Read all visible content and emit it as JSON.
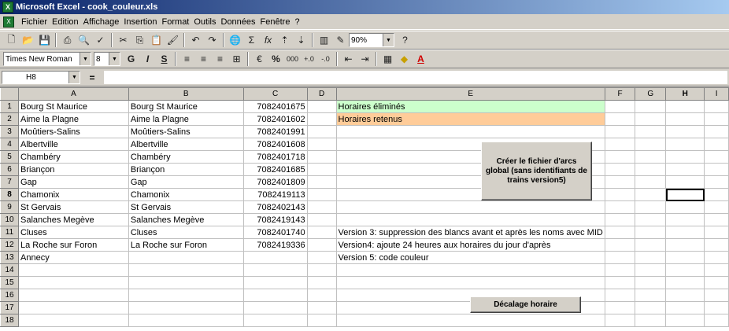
{
  "window": {
    "title": "Microsoft Excel - cook_couleur.xls"
  },
  "menu": [
    "Fichier",
    "Edition",
    "Affichage",
    "Insertion",
    "Format",
    "Outils",
    "Données",
    "Fenêtre",
    "?"
  ],
  "toolbar": {
    "zoom": "90%"
  },
  "format_toolbar": {
    "font": "Times New Roman",
    "size": "8",
    "bold": "G",
    "italic": "I",
    "underline": "S",
    "percent": "%",
    "thousands": "000"
  },
  "formula_bar": {
    "cell_ref": "H8",
    "equals": "="
  },
  "columns": [
    "A",
    "B",
    "C",
    "D",
    "E",
    "F",
    "G",
    "H",
    "I"
  ],
  "rows": [
    {
      "n": "1",
      "a": "Bourg St Maurice",
      "b": "Bourg St Maurice",
      "c": "7082401675",
      "e": "Horaires éliminés"
    },
    {
      "n": "2",
      "a": "Aime la Plagne",
      "b": "Aime la Plagne",
      "c": "7082401602",
      "e": "Horaires retenus"
    },
    {
      "n": "3",
      "a": "Moûtiers-Salins",
      "b": "Moûtiers-Salins",
      "c": "7082401991",
      "e": ""
    },
    {
      "n": "4",
      "a": "Albertville",
      "b": "Albertville",
      "c": "7082401608",
      "e": ""
    },
    {
      "n": "5",
      "a": "Chambéry",
      "b": "Chambéry",
      "c": "7082401718",
      "e": ""
    },
    {
      "n": "6",
      "a": "Briançon",
      "b": "Briançon",
      "c": "7082401685",
      "e": ""
    },
    {
      "n": "7",
      "a": "Gap",
      "b": "Gap",
      "c": "7082401809",
      "e": ""
    },
    {
      "n": "8",
      "a": "Chamonix",
      "b": "Chamonix",
      "c": "7082419113",
      "e": ""
    },
    {
      "n": "9",
      "a": "St Gervais",
      "b": "St Gervais",
      "c": "7082402143",
      "e": ""
    },
    {
      "n": "10",
      "a": "Salanches Megève",
      "b": "Salanches Megève",
      "c": "7082419143",
      "e": ""
    },
    {
      "n": "11",
      "a": "Cluses",
      "b": "Cluses",
      "c": "7082401740",
      "e": "Version 3: suppression des blancs avant et après les noms avec MID"
    },
    {
      "n": "12",
      "a": "La Roche sur Foron",
      "b": "La Roche sur Foron",
      "c": "7082419336",
      "e": "Version4: ajoute 24 heures aux horaires du jour d'après"
    },
    {
      "n": "13",
      "a": "Annecy",
      "b": "",
      "c": "",
      "e": "Version 5: code couleur"
    },
    {
      "n": "14",
      "a": "",
      "b": "",
      "c": "",
      "e": ""
    },
    {
      "n": "15",
      "a": "",
      "b": "",
      "c": "",
      "e": ""
    },
    {
      "n": "16",
      "a": "",
      "b": "",
      "c": "",
      "e": ""
    },
    {
      "n": "17",
      "a": "",
      "b": "",
      "c": "",
      "e": ""
    },
    {
      "n": "18",
      "a": "",
      "b": "",
      "c": "",
      "e": ""
    }
  ],
  "buttons": {
    "create_arcs": "Créer le fichier d'arcs global (sans identifiants de trains version5)",
    "time_shift": "Décalage horaire"
  },
  "colors": {
    "eliminated": "#ccffcc",
    "retained": "#ffcc99",
    "title_start": "#0a246a"
  }
}
